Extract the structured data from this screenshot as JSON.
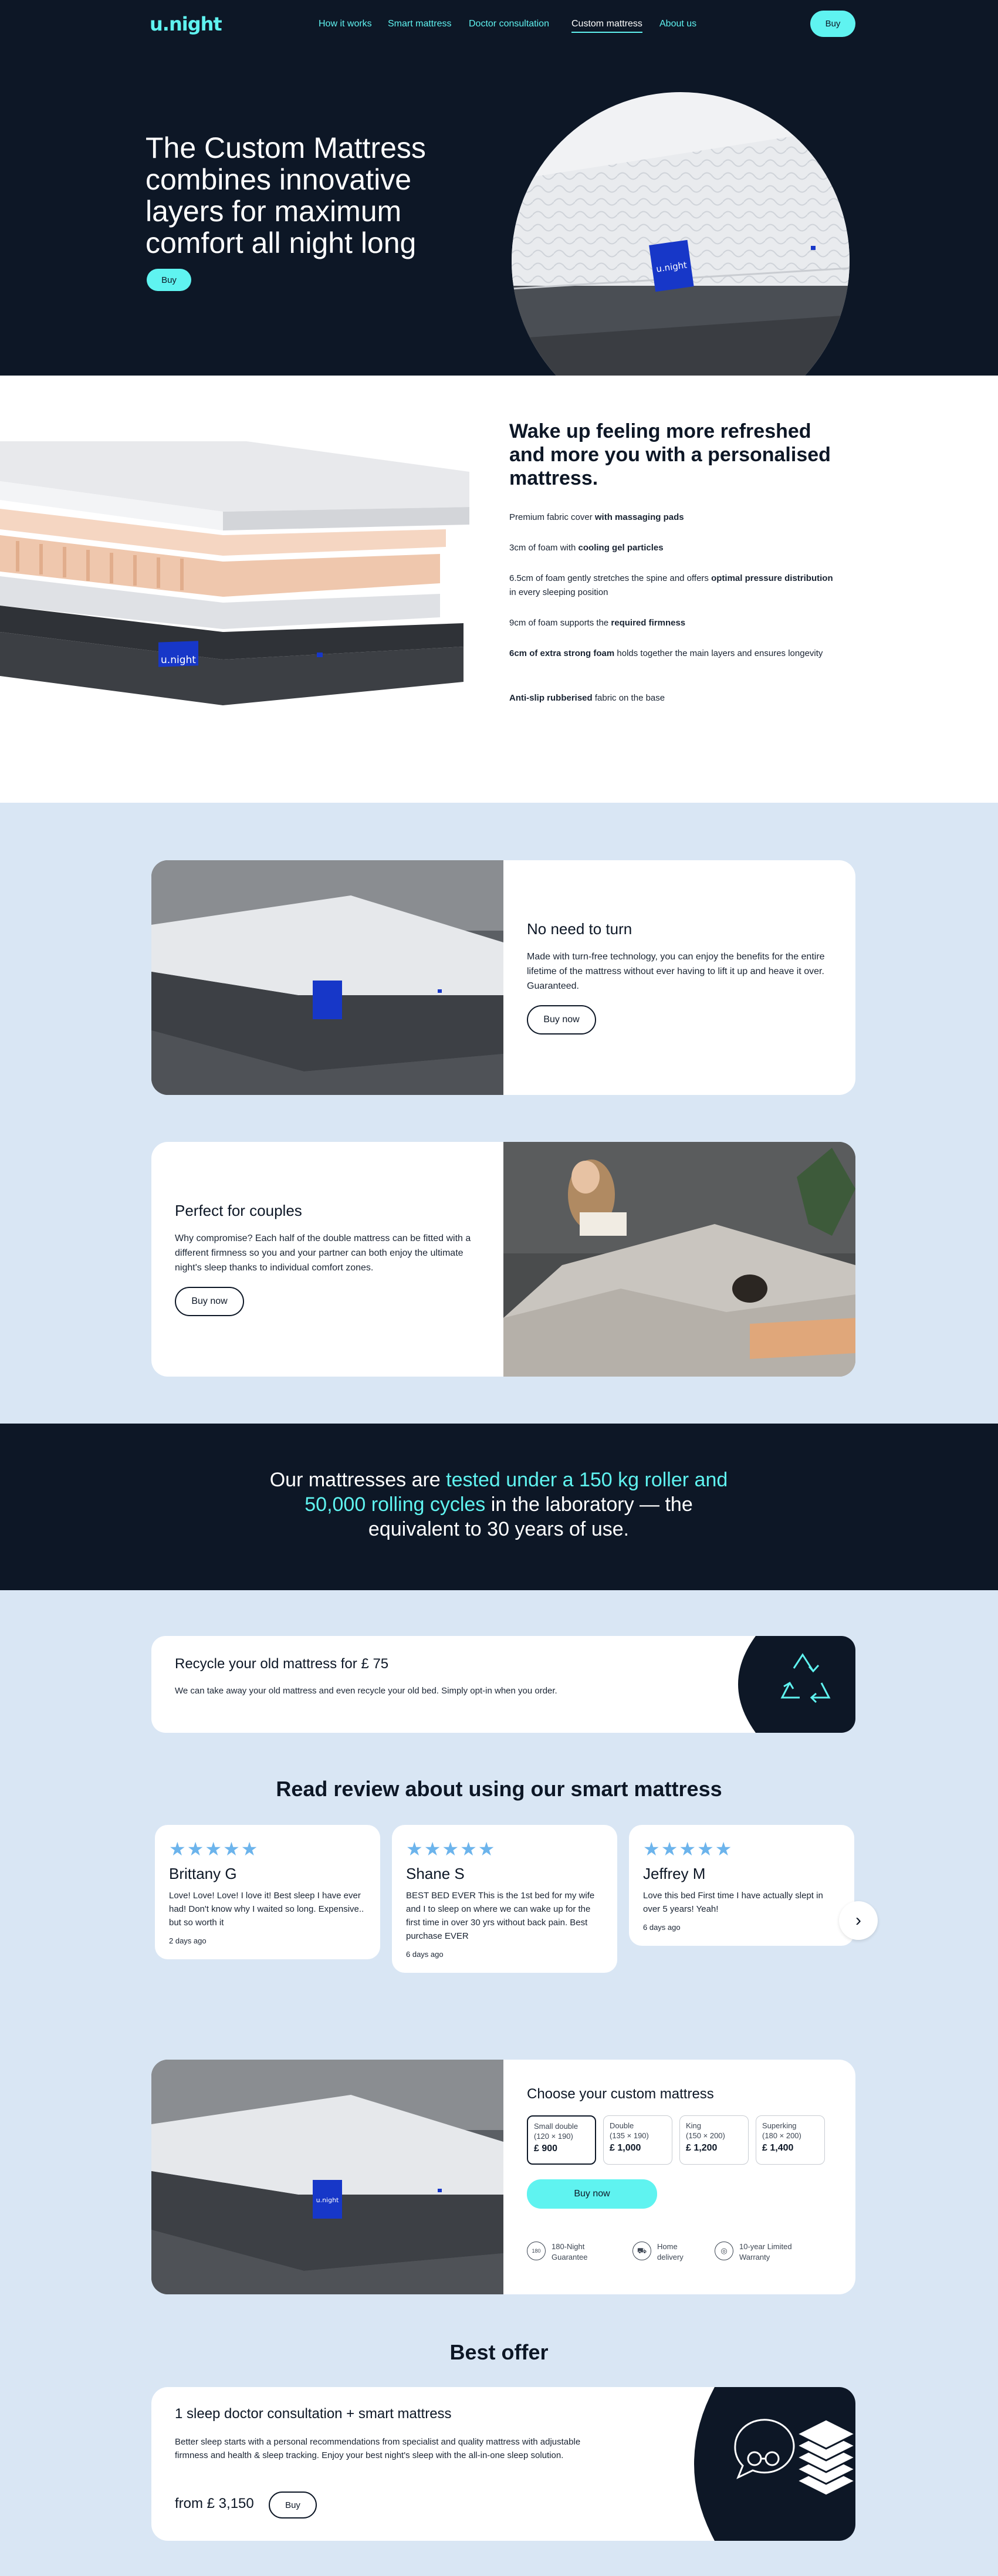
{
  "header": {
    "logo": "u.night",
    "nav": [
      "How it works",
      "Smart mattress",
      "Doctor consultation",
      "Custom mattress",
      "About us"
    ],
    "buy_label": "Buy"
  },
  "hero": {
    "title": "The Custom Mattress combines innovative layers for maximum comfort all night long",
    "buy_label": "Buy",
    "badge_logo": "u.night"
  },
  "layers": {
    "heading": "Wake up feeling more refreshed and more you with a personalised mattress.",
    "badge_logo": "u.night",
    "items": [
      {
        "pre": "Premium fabric cover ",
        "bold": "with massaging pads",
        "post": ""
      },
      {
        "pre": "3cm of foam with ",
        "bold": "cooling gel particles",
        "post": ""
      },
      {
        "pre": "6.5cm of foam gently stretches the spine and offers ",
        "bold": "optimal pressure distribution",
        "post": " in every sleeping position"
      },
      {
        "pre": "9cm of foam supports the ",
        "bold": "required firmness",
        "post": ""
      },
      {
        "pre": "",
        "bold": "6cm of extra strong foam",
        "post": " holds together the main layers and ensures longevity"
      },
      {
        "pre": "",
        "bold": "Anti-slip rubberised",
        "post": " fabric on the base"
      }
    ]
  },
  "features": [
    {
      "title": "No need to turn",
      "text": "Made with turn-free technology, you can enjoy the benefits for the entire lifetime of the mattress without ever having to lift it up and heave it over. Guaranteed.",
      "button": "Buy now"
    },
    {
      "title": "Perfect for couples",
      "text": "Why compromise? Each half of the double mattress can be fitted with a different firmness so you and your partner can both enjoy the ultimate night's sleep thanks to individual comfort zones.",
      "button": "Buy now"
    }
  ],
  "banner": {
    "pre": "Our mattresses are ",
    "highlight": "tested under a 150 kg roller and 50,000 rolling cycles",
    "post": " in the laboratory — the equivalent to 30 years of use."
  },
  "recycle": {
    "title": "Recycle your old mattress for £ 75",
    "text": "We can take away your old mattress and even recycle your old bed. Simply opt-in when you order.",
    "icon": "recycle-icon"
  },
  "reviews": {
    "heading": "Read review about using our smart mattress",
    "items": [
      {
        "stars": "★★★★★",
        "name": "Brittany G",
        "text": "Love! Love! Love! I love it! Best sleep I have ever had! Don't know why I waited so long. Expensive.. but so worth it",
        "date": "2 days ago"
      },
      {
        "stars": "★★★★★",
        "name": "Shane S",
        "text": "BEST BED EVER This is the 1st bed for my wife and I to sleep on where we can wake up for the first time in over 30 yrs without back pain. Best purchase EVER",
        "date": "6 days ago"
      },
      {
        "stars": "★★★★★",
        "name": "Jeffrey M",
        "text": "Love this bed First time I have actually slept in over 5 years! Yeah!",
        "date": "6 days ago"
      }
    ],
    "next_icon": "chevron-right-icon"
  },
  "choose": {
    "title": "Choose your custom mattress",
    "badge_logo": "u.night",
    "sizes": [
      {
        "name": "Small double",
        "dim": "(120 × 190)",
        "price": "£ 900",
        "selected": true
      },
      {
        "name": "Double",
        "dim": "(135 × 190)",
        "price": "£ 1,000",
        "selected": false
      },
      {
        "name": "King",
        "dim": "(150 × 200)",
        "price": "£ 1,200",
        "selected": false
      },
      {
        "name": "Superking",
        "dim": "(180 × 200)",
        "price": "£ 1,400",
        "selected": false
      }
    ],
    "buy_label": "Buy now",
    "guarantees": [
      {
        "icon": "180-night-icon",
        "glyph": "180",
        "line1": "180-Night",
        "line2": "Guarantee"
      },
      {
        "icon": "delivery-truck-icon",
        "glyph": "⛟",
        "line1": "Home",
        "line2": "delivery"
      },
      {
        "icon": "warranty-badge-icon",
        "glyph": "◎",
        "line1": "10-year Limited",
        "line2": "Warranty"
      }
    ]
  },
  "offer": {
    "heading": "Best offer",
    "title": "1 sleep doctor consultation + smart mattress",
    "text": "Better sleep starts with a personal recommendations from specialist and quality mattress with adjustable firmness and health & sleep tracking. Enjoy your best night's sleep with the all-in-one sleep solution.",
    "price": "from £ 3,150",
    "buy_label": "Buy"
  },
  "colors": {
    "navy": "#0d1726",
    "cyan": "#5ff3f0",
    "light_blue": "#d9e6f4",
    "brand_blue": "#1737c8",
    "star": "#6cb4ec"
  }
}
